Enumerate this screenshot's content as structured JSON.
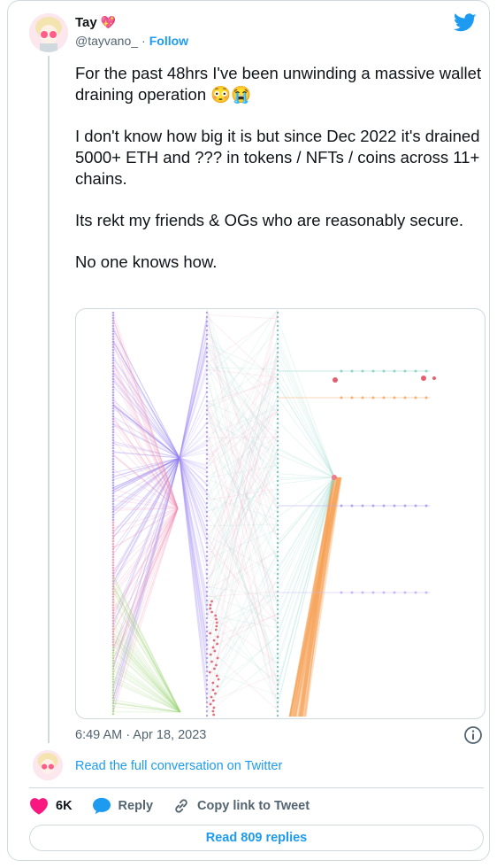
{
  "author": {
    "name": "Tay",
    "emoji": "💖",
    "handle": "@tayvano_",
    "separator": "·",
    "follow_label": "Follow"
  },
  "tweet": {
    "paragraphs": [
      "For the past 48hrs I've been unwinding a massive wallet draining operation 😳😭",
      "I don't know how big it is but since Dec 2022 it's drained 5000+ ETH and ??? in tokens / NFTs / coins across 11+ chains.",
      "Its rekt my friends & OGs who are reasonably secure.",
      "No one knows how."
    ],
    "timestamp": "6:49 AM · Apr 18, 2023"
  },
  "media": {
    "alt_icon": "network-graph-image"
  },
  "thread": {
    "read_full_label": "Read the full conversation on Twitter"
  },
  "actions": {
    "likes": "6K",
    "reply_label": "Reply",
    "copy_link_label": "Copy link to Tweet"
  },
  "footer": {
    "read_replies_label": "Read 809 replies"
  },
  "colors": {
    "accent": "#1d9bf0",
    "like": "#f91880",
    "muted": "#536471",
    "border": "#cfd9de",
    "twitter_blue": "#1d9bf0"
  }
}
